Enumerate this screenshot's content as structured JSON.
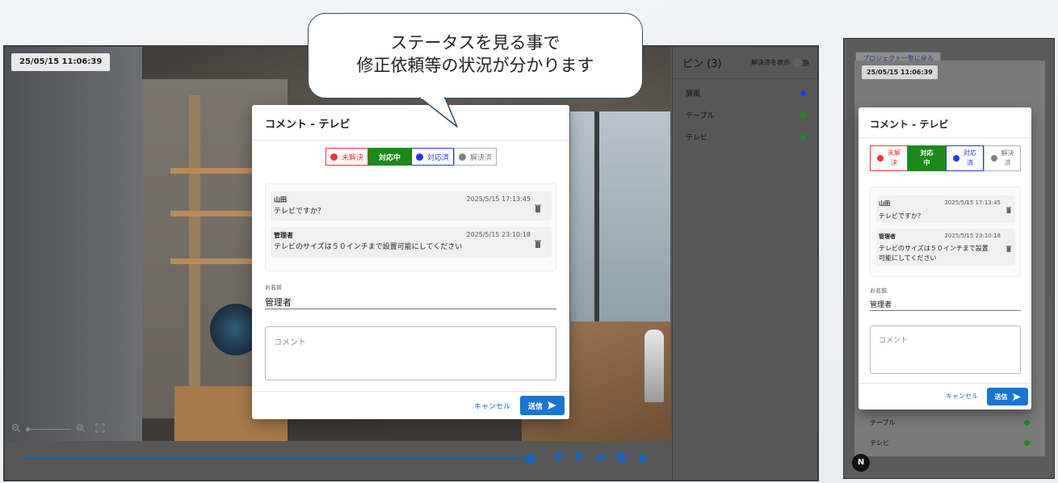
{
  "callout": {
    "line1": "ステータスを見る事で",
    "line2": "修正依頼等の状況が分かります"
  },
  "viewer": {
    "timestamp": "25/05/15 11:06:39"
  },
  "pin_panel": {
    "title": "ピン (3)",
    "show_resolved_label": "解決済を表示",
    "pins": [
      {
        "label": "屏風",
        "color": "#1e3be8"
      },
      {
        "label": "テーブル",
        "color": "#1b8a1b"
      },
      {
        "label": "テレビ",
        "color": "#1b8a1b"
      }
    ]
  },
  "dialog": {
    "title": "コメント - テレビ",
    "statuses": [
      {
        "label": "未解決",
        "color": "#e53935"
      },
      {
        "label": "対応中",
        "color": "#1b8a1b"
      },
      {
        "label": "対応済",
        "color": "#1e3be8"
      },
      {
        "label": "解決済",
        "color": "#808080"
      }
    ],
    "comments": [
      {
        "author": "山田",
        "date": "2025/5/15 17:13:45",
        "body": "テレビですか？"
      },
      {
        "author": "管理者",
        "date": "2025/5/15 23:10:18",
        "body": "テレビのサイズは５０インチまで設置可能にしてください"
      }
    ],
    "name_label": "お名前",
    "name_value": "管理者",
    "comment_placeholder": "コメント",
    "cancel_label": "キャンセル",
    "send_label": "送信"
  },
  "mobile": {
    "back_label": "プロジェクト一覧に戻る",
    "timestamp": "25/05/15 11:06:39",
    "status_labels": [
      {
        "line1": "未解",
        "line2": "決"
      },
      {
        "line1": "対応",
        "line2": "中"
      },
      {
        "line1": "対応",
        "line2": "済"
      },
      {
        "line1": "解決",
        "line2": "済"
      }
    ],
    "comment2_line1": "テレビのサイズは５０インチまで設置",
    "comment2_line2": "可能にしてください",
    "pins_visible": [
      {
        "label": "テーブル",
        "color": "#1b8a1b"
      },
      {
        "label": "テレビ",
        "color": "#1b8a1b"
      }
    ],
    "avatar_letter": "N"
  }
}
